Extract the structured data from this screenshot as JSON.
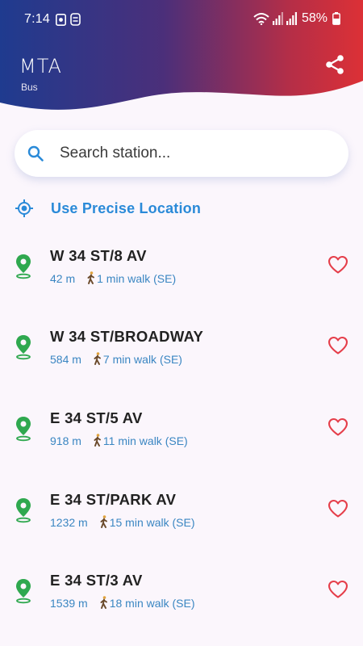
{
  "status_bar": {
    "time": "7:14",
    "battery": "58%"
  },
  "header": {
    "title": "MTA",
    "subtitle": "Bus",
    "share_icon": "share-icon",
    "gradient_colors": [
      "#2a3a8c",
      "#d93240"
    ]
  },
  "search": {
    "placeholder": "Search station...",
    "value": ""
  },
  "precise_location": {
    "label": "Use Precise Location"
  },
  "stations": [
    {
      "name": "W 34 ST/8 AV",
      "distance": "42 m",
      "walk": "1 min walk (SE)"
    },
    {
      "name": "W 34 ST/BROADWAY",
      "distance": "584 m",
      "walk": "7 min walk (SE)"
    },
    {
      "name": "E 34 ST/5 AV",
      "distance": "918 m",
      "walk": "11 min walk (SE)"
    },
    {
      "name": "E 34 ST/PARK AV",
      "distance": "1232 m",
      "walk": "15 min walk (SE)"
    },
    {
      "name": "E 34 ST/3 AV",
      "distance": "1539 m",
      "walk": "18 min walk (SE)"
    }
  ],
  "colors": {
    "accent_blue": "#2a8ad8",
    "pin_green": "#2fa84f",
    "heart_red": "#e53e4a"
  }
}
